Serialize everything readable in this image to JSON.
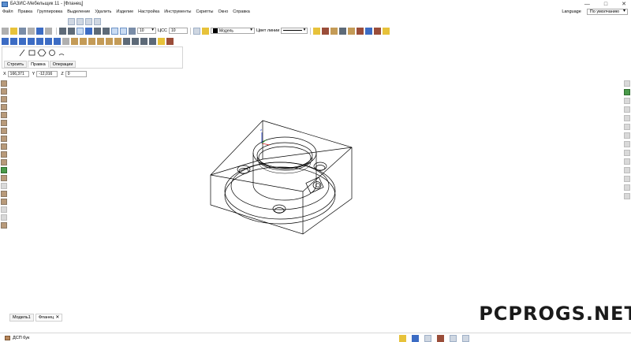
{
  "window": {
    "title": "БАЗИС-Мебельщик 11 - [Фланец]",
    "controls": [
      "—",
      "□",
      "✕"
    ]
  },
  "menu": {
    "items": [
      "Файл",
      "Правка",
      "Группировка",
      "Выделение",
      "Удалить",
      "Изделие",
      "Настройка",
      "Инструменты",
      "Скрипты",
      "Окно",
      "Справка"
    ],
    "language_label": "Language",
    "preset_value": "По умолчанию"
  },
  "toolbar": {
    "line_width_value": "10",
    "ucs_label": "ЦСС",
    "ucs_value": "10",
    "layer_value": "Модель",
    "line_type_label": "Цвет линии"
  },
  "subpanel": {
    "tabs": [
      "Строить",
      "Правка",
      "Операции"
    ],
    "active_tab": "Правка"
  },
  "coords": {
    "x_label": "X",
    "x_value": "166,371",
    "y_label": "Y",
    "y_value": "-12,016",
    "z_label": "Z",
    "z_value": "0"
  },
  "doc_tabs": {
    "items": [
      "Модель1",
      "Фланец"
    ],
    "active": "Фланец",
    "close_glyph": "✕"
  },
  "status": {
    "material": "ДСП бук"
  },
  "watermark": {
    "text": "PCPROGS.NET"
  },
  "colors": {
    "accent": "#3c6cc4",
    "model_line": "#000000",
    "axis_x": "#d02020",
    "axis_y": "#20a020",
    "axis_z": "#2040d0"
  }
}
